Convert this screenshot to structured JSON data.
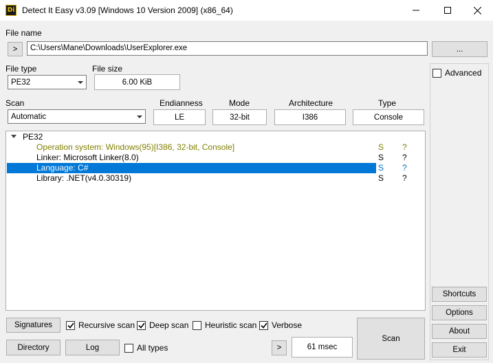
{
  "window": {
    "title": "Detect It Easy v3.09 [Windows 10 Version 2009] (x86_64)",
    "icon_label": "Di",
    "controls": {
      "minimize": "minimize-icon",
      "maximize": "maximize-icon",
      "close": "close-icon"
    }
  },
  "file": {
    "label": "File name",
    "browse_arrow": ">",
    "path": "C:\\Users\\Mane\\Downloads\\UserExplorer.exe",
    "ellipsis": "..."
  },
  "file_type": {
    "label": "File type",
    "value": "PE32"
  },
  "file_size": {
    "label": "File size",
    "value": "6.00 KiB"
  },
  "advanced": {
    "label": "Advanced",
    "checked": false
  },
  "scan": {
    "label": "Scan",
    "mode_value": "Automatic",
    "endianness": {
      "label": "Endianness",
      "value": "LE"
    },
    "mode": {
      "label": "Mode",
      "value": "32-bit"
    },
    "architecture": {
      "label": "Architecture",
      "value": "I386"
    },
    "type": {
      "label": "Type",
      "value": "Console"
    }
  },
  "results": {
    "root": "PE32",
    "items": [
      {
        "text": "Operation system: Windows(95)[I386, 32-bit, Console]",
        "s": "S",
        "q": "?",
        "style": "olive"
      },
      {
        "text": "Linker: Microsoft Linker(8.0)",
        "s": "S",
        "q": "?",
        "style": "normal"
      },
      {
        "text": "Language: C#",
        "s": "S",
        "q": "?",
        "style": "selected"
      },
      {
        "text": "Library: .NET(v4.0.30319)",
        "s": "S",
        "q": "?",
        "style": "normal"
      }
    ]
  },
  "bottom": {
    "signatures": "Signatures",
    "recursive_scan": {
      "label": "Recursive scan",
      "checked": true
    },
    "deep_scan": {
      "label": "Deep scan",
      "checked": true
    },
    "heuristic_scan": {
      "label": "Heuristic scan",
      "checked": false
    },
    "verbose": {
      "label": "Verbose",
      "checked": true
    },
    "directory": "Directory",
    "log": "Log",
    "all_types": {
      "label": "All types",
      "checked": false
    },
    "next_arrow": ">",
    "elapsed": "61 msec",
    "scan_button": "Scan"
  },
  "side_buttons": {
    "shortcuts": "Shortcuts",
    "options": "Options",
    "about": "About",
    "exit": "Exit"
  },
  "colors": {
    "selection": "#0078d7",
    "olive_text": "#808000",
    "teal_text": "#0070c0",
    "window_bg": "#f0f0f0"
  }
}
